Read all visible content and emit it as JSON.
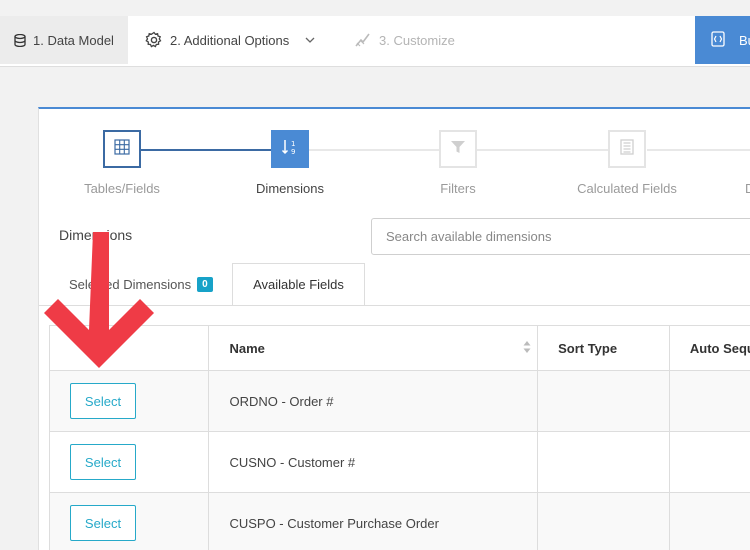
{
  "topbar": {
    "tabs": [
      {
        "label": "1. Data Model",
        "icon": "database-icon"
      },
      {
        "label": "2. Additional Options",
        "icon": "gear-icon"
      },
      {
        "label": "3. Customize",
        "icon": "brush-icon"
      }
    ],
    "build_label": "Bu"
  },
  "stepper": {
    "steps": [
      {
        "label": "Tables/Fields",
        "icon": "grid-icon",
        "state": "done"
      },
      {
        "label": "Dimensions",
        "icon": "sort-numeric-icon",
        "state": "active"
      },
      {
        "label": "Filters",
        "icon": "filter-icon",
        "state": "pending"
      },
      {
        "label": "Calculated Fields",
        "icon": "calculator-icon",
        "state": "pending"
      },
      {
        "label": "D",
        "icon": "",
        "state": "pending"
      }
    ]
  },
  "dimensions": {
    "title": "Dimensions",
    "search_placeholder": "Search available dimensions"
  },
  "subtabs": {
    "selected_label": "Selected Dimensions",
    "selected_count": "0",
    "available_label": "Available Fields"
  },
  "table": {
    "headers": {
      "name": "Name",
      "sort_type": "Sort Type",
      "auto_seq": "Auto Sequ"
    },
    "select_label": "Select",
    "rows": [
      {
        "name": "ORDNO - Order #"
      },
      {
        "name": "CUSNO - Customer #"
      },
      {
        "name": "CUSPO - Customer Purchase Order"
      }
    ]
  },
  "colors": {
    "accent": "#4a8ad4",
    "select_button": "#26a9c9",
    "badge": "#17a2c8",
    "arrow": "#ef3b46"
  }
}
